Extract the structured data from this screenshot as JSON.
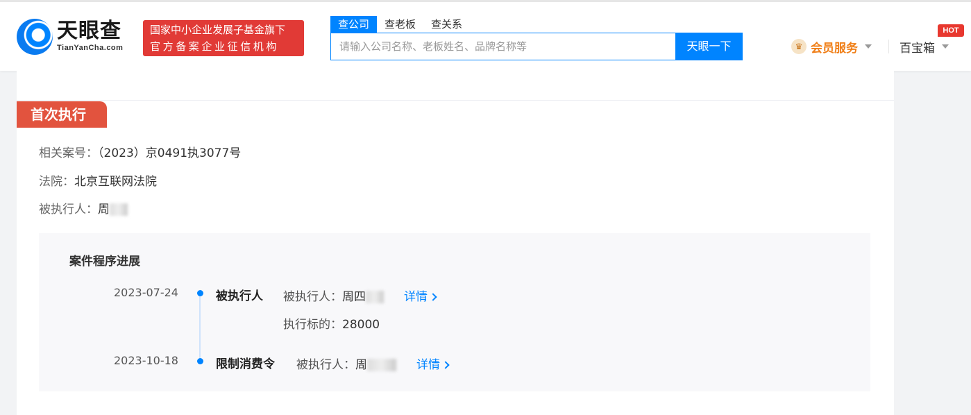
{
  "header": {
    "logo_cn": "天眼查",
    "logo_en": "TianYanCha.com",
    "badge_line1": "国家中小企业发展子基金旗下",
    "badge_line2": "官方备案企业征信机构",
    "search_tabs": [
      {
        "label": "查公司",
        "active": true
      },
      {
        "label": "查老板",
        "active": false
      },
      {
        "label": "查关系",
        "active": false
      }
    ],
    "search_placeholder": "请输入公司名称、老板姓名、品牌名称等",
    "search_button": "天眼一下",
    "vip_label": "会员服务",
    "toolbox_label": "百宝箱",
    "hot_badge": "HOT"
  },
  "section": {
    "tag": "首次执行",
    "case_no_label": "相关案号：",
    "case_no": "（2023）京0491执3077号",
    "court_label": "法院：",
    "court": "北京互联网法院",
    "executed_label": "被执行人：",
    "executed_name_visible": "周"
  },
  "progress": {
    "title": "案件程序进展",
    "events": [
      {
        "date": "2023-07-24",
        "type": "被执行人",
        "person_label": "被执行人：",
        "person_visible": "周四",
        "amount_label": "执行标的：",
        "amount": "28000",
        "detail": "详情"
      },
      {
        "date": "2023-10-18",
        "type": "限制消费令",
        "person_label": "被执行人：",
        "person_visible": "周",
        "detail": "详情"
      }
    ]
  },
  "colors": {
    "brand_blue": "#0084ff",
    "badge_red": "#e13a36",
    "tag_red": "#e2533e",
    "vip_orange": "#f07f18"
  }
}
